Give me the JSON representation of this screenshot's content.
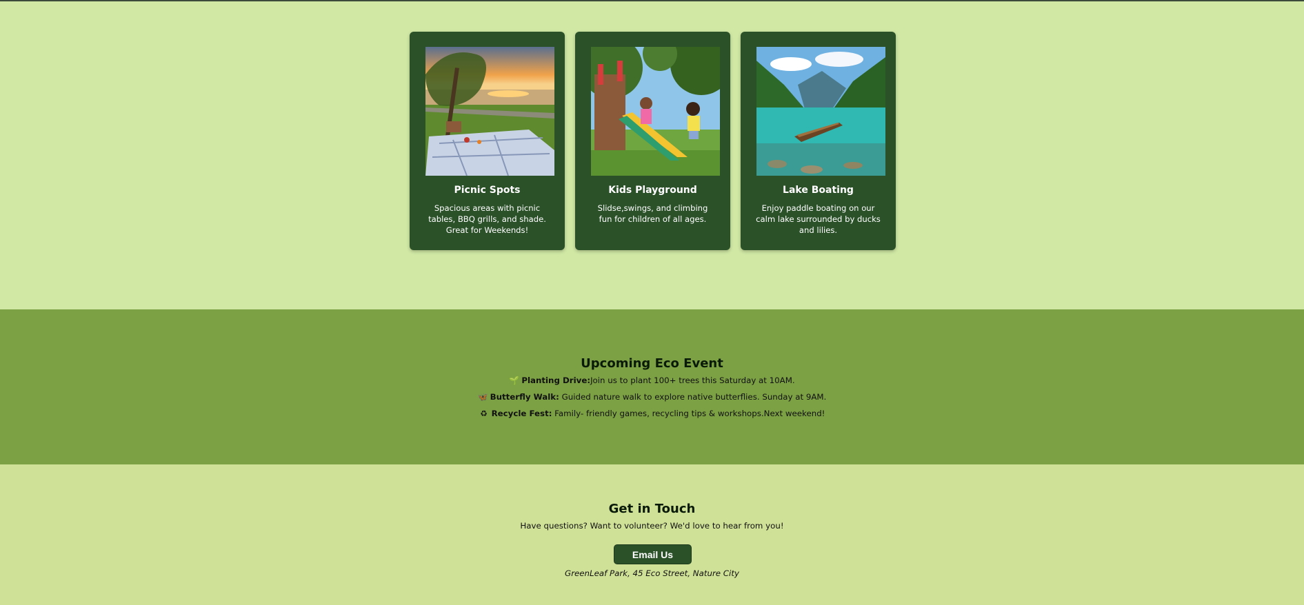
{
  "activities": {
    "cards": [
      {
        "image_alt": "picnic blanket under a willow tree at sunset by a lake",
        "title": "Picnic Spots",
        "description": "Spacious areas with picnic tables, BBQ grills, and shade. Great for Weekends!"
      },
      {
        "image_alt": "children playing on a playground slide",
        "title": "Kids Playground",
        "description": "Slidse,swings, and climbing fun for children of all ages."
      },
      {
        "image_alt": "wooden canoe on a clear turquoise mountain lake",
        "title": "Lake Boating",
        "description": "Enjoy paddle boating on our calm lake surrounded by ducks and lilies."
      }
    ]
  },
  "events": {
    "title": "Upcoming Eco Event",
    "items": [
      {
        "icon": "seedling-icon",
        "glyph": "🌱",
        "name": "Planting Drive:",
        "text": "Join us to plant 100+ trees this Saturday at 10AM."
      },
      {
        "icon": "butterfly-icon",
        "glyph": "🦋",
        "name": "Butterfly Walk:",
        "text": " Guided nature walk to explore native butterflies. Sunday at 9AM."
      },
      {
        "icon": "recycle-icon",
        "glyph": "♻",
        "name": "Recycle Fest:",
        "text": " Family- friendly games, recycling tips & workshops.Next weekend!"
      }
    ]
  },
  "contact": {
    "title": "Get in Touch",
    "subtitle": "Have questions? Want to volunteer? We'd love to hear from you!",
    "button_label": "Email Us",
    "address": "GreenLeaf Park, 45 Eco Street, Nature City"
  },
  "colors": {
    "page_bg": "#d0e8a4",
    "card_bg": "#2b5129",
    "events_bg": "#7ca044",
    "contact_bg": "#cfe196"
  }
}
